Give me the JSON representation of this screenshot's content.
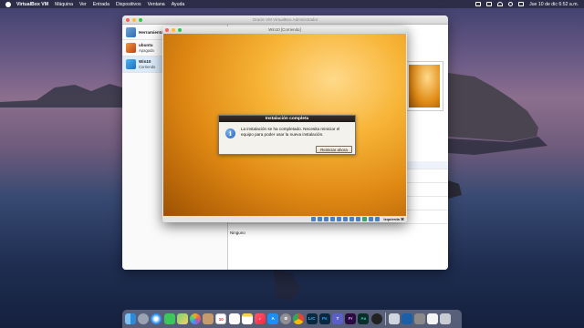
{
  "menubar": {
    "app_name": "VirtualBox VM",
    "items": [
      "Máquina",
      "Ver",
      "Entrada",
      "Dispositivos",
      "Ventana",
      "Ayuda"
    ],
    "clock": "Jue 10 de dic  6:52 a.m."
  },
  "manager": {
    "title": "Oracle VM VirtualBox Administrador",
    "tools_label": "Herramientas",
    "vms": [
      {
        "name": "ubuntu",
        "state": "Apagada"
      },
      {
        "name": "Win10",
        "state": "Corriendo"
      }
    ],
    "detail_value": "Ninguno"
  },
  "vm_window": {
    "title": "Win10 [Corriendo]",
    "host_key": "Izquierda ⌘"
  },
  "dialog": {
    "title": "Instalación completa",
    "message": "La instalación se ha completado. Necesita reiniciar el equipo para poder usar la nueva instalación.",
    "button_label": "Reiniciar ahora"
  },
  "dock": {
    "items": [
      "finder-icon",
      "launchpad-icon",
      "safari-icon",
      "messages-icon",
      "maps-icon",
      "photos-icon",
      "contacts-icon",
      "calendar-icon",
      "reminders-icon",
      "notes-icon",
      "music-icon",
      "appstore-icon",
      "settings-icon",
      "chrome-icon",
      "lightroom-icon",
      "photoshop-icon",
      "teams-icon",
      "premiere-icon",
      "audition-icon",
      "obs-icon",
      "preview-icon",
      "virtualbox-icon",
      "vmware-icon",
      "file-icon",
      "trash-icon"
    ],
    "labels": {
      "lightroom": "LrC",
      "photoshop": "Ps",
      "premiere": "Pr",
      "audition": "Au"
    }
  }
}
